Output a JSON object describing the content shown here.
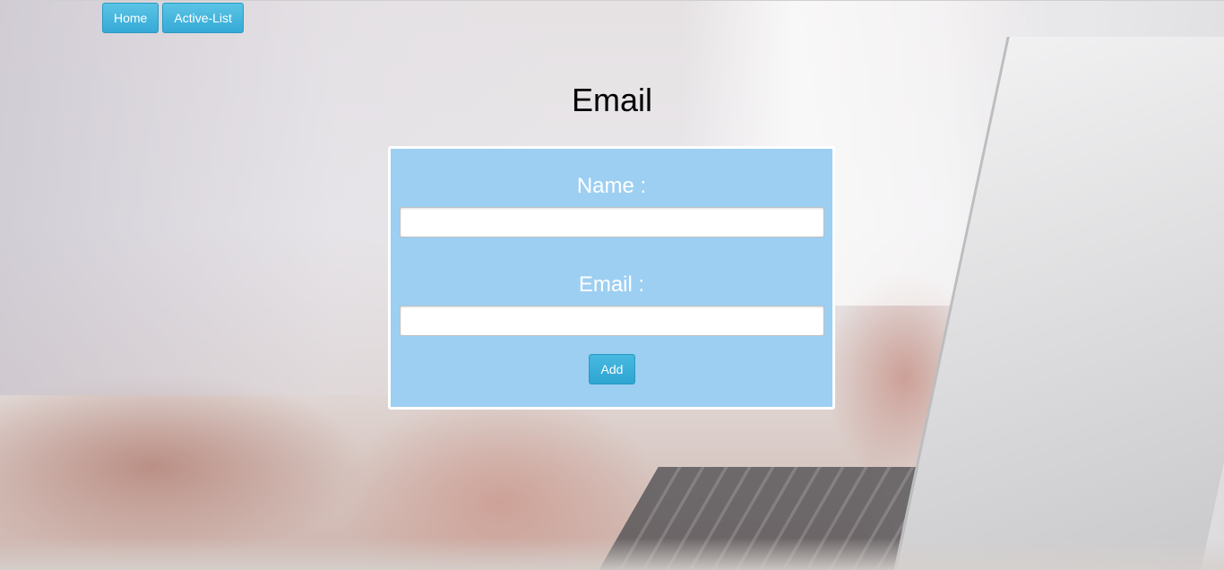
{
  "nav": {
    "home_label": "Home",
    "active_list_label": "Active-List"
  },
  "page": {
    "title": "Email"
  },
  "form": {
    "name_label": "Name :",
    "name_value": "",
    "email_label": "Email :",
    "email_value": "",
    "add_label": "Add"
  },
  "colors": {
    "nav_button": "#39ADD9",
    "card_background": "#9DCFF2",
    "label_text": "#FFFFFF"
  }
}
